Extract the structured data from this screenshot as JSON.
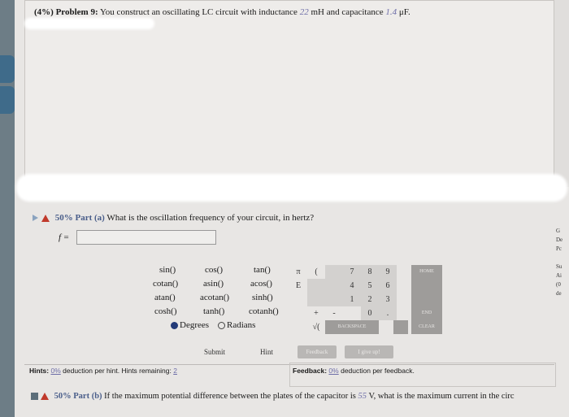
{
  "problem": {
    "prefix": "(4%) Problem 9:",
    "text1": "You construct an oscillating LC circuit with inductance",
    "inductance": "22",
    "text2": "mH and capacitance",
    "capacitance": "1.4",
    "unit": "μF."
  },
  "part_a": {
    "percent": "50% Part (a)",
    "question": "What is the oscillation frequency of your circuit, in hertz?",
    "answer_label": "f ="
  },
  "keypad": {
    "functions": [
      "sin()",
      "cos()",
      "tan()",
      "cotan()",
      "asin()",
      "acos()",
      "atan()",
      "acotan()",
      "sinh()",
      "cosh()",
      "tanh()",
      "cotanh()"
    ],
    "symbols": [
      "π",
      "(",
      "E",
      "+",
      "-",
      "√("
    ],
    "digits": [
      "7",
      "8",
      "9",
      "4",
      "5",
      "6",
      "1",
      "2",
      "3",
      "0",
      "."
    ],
    "home": "HOME",
    "end": "END",
    "backspace": "BACKSPACE",
    "clear": "CLEAR",
    "degrees": "Degrees",
    "radians": "Radians"
  },
  "buttons": {
    "submit": "Submit",
    "hint": "Hint",
    "feedback": "Feedback",
    "give_up": "I give up!"
  },
  "hints": {
    "label": "Hints:",
    "pct": "0%",
    "text": "deduction per hint. Hints remaining:",
    "remaining": "2"
  },
  "feedback": {
    "label": "Feedback:",
    "pct": "0%",
    "text": "deduction per feedback."
  },
  "part_b": {
    "percent": "50% Part (b)",
    "text1": "If the maximum potential difference between the plates of the capacitor is",
    "voltage": "55",
    "text2": "V, what is the maximum current in the circ"
  },
  "right_side": [
    "G",
    "De",
    "Pc",
    "Su",
    "Ai",
    "(0",
    "de"
  ]
}
